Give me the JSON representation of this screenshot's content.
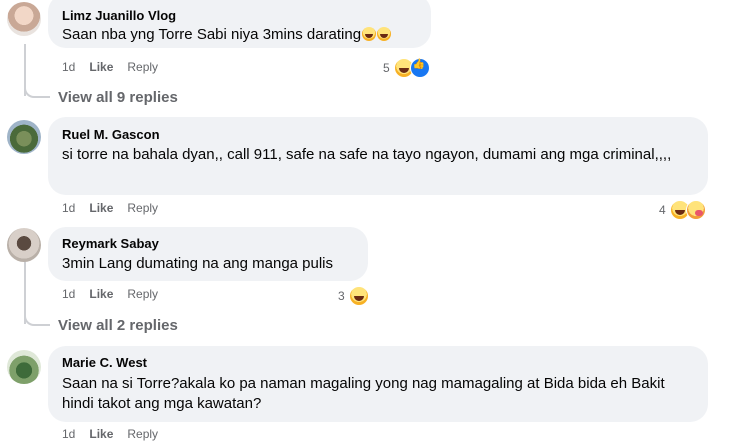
{
  "comments": [
    {
      "author": "Limz Juanillo Vlog",
      "text": "Saan nba yng Torre Sabi niya 3mins darating",
      "time": "1d",
      "like": "Like",
      "reply": "Reply",
      "reaction_count": "5",
      "reactions": [
        "haha-icon",
        "like-icon"
      ],
      "inline_emojis": 2
    },
    {
      "author": "Ruel M. Gascon",
      "text": "si torre na bahala dyan,, call 911, safe na safe na tayo ngayon, dumami ang mga criminal,,,,",
      "time": "1d",
      "like": "Like",
      "reply": "Reply",
      "reaction_count": "4",
      "reactions": [
        "haha-icon",
        "care-icon"
      ]
    },
    {
      "author": "Reymark Sabay",
      "text": "3min Lang dumating na ang manga pulis",
      "time": "1d",
      "like": "Like",
      "reply": "Reply",
      "reaction_count": "3",
      "reactions": [
        "haha-icon"
      ]
    },
    {
      "author": "Marie C. West",
      "text": "Saan na si Torre?akala ko pa naman magaling yong nag mamagaling at Bida bida eh Bakit hindi takot ang mga kawatan?",
      "time": "1d",
      "like": "Like",
      "reply": "Reply"
    }
  ],
  "view_replies": [
    "View all 9 replies",
    "View all 2 replies"
  ]
}
